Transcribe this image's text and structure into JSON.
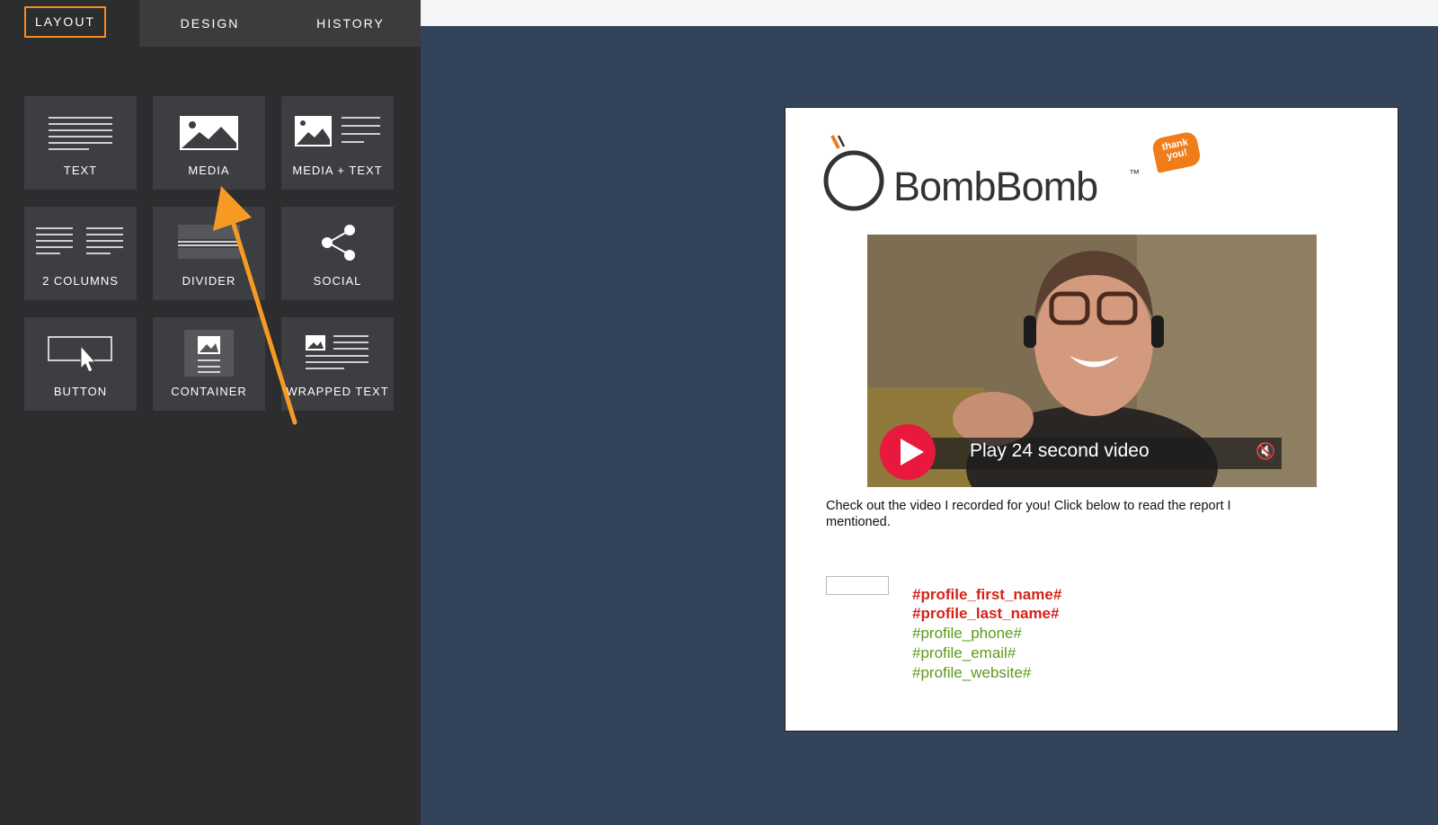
{
  "tabs": [
    {
      "label": "LAYOUT"
    },
    {
      "label": "DESIGN"
    },
    {
      "label": "HISTORY"
    }
  ],
  "tiles": [
    {
      "label": "TEXT",
      "icon": "text-lines-icon"
    },
    {
      "label": "MEDIA",
      "icon": "image-icon"
    },
    {
      "label": "MEDIA + TEXT",
      "icon": "image-text-icon"
    },
    {
      "label": "2 COLUMNS",
      "icon": "two-columns-icon"
    },
    {
      "label": "DIVIDER",
      "icon": "divider-icon"
    },
    {
      "label": "SOCIAL",
      "icon": "share-icon"
    },
    {
      "label": "BUTTON",
      "icon": "button-cursor-icon"
    },
    {
      "label": "CONTAINER",
      "icon": "container-icon"
    },
    {
      "label": "WRAPPED TEXT",
      "icon": "wrapped-text-icon"
    }
  ],
  "email": {
    "logo_text": "BombBomb",
    "logo_tm": "™",
    "badge_text": "thank you!",
    "video": {
      "play_label": "Play 24 second video",
      "mute_icon": "mute-icon"
    },
    "body_text": "Check out the video I recorded for you! Click below to read the report I mentioned.",
    "signature": {
      "first_name": "#profile_first_name#",
      "last_name": "#profile_last_name#",
      "phone": "#profile_phone#",
      "email": "#profile_email#",
      "website": "#profile_website#"
    }
  },
  "colors": {
    "sidebar_bg": "#2c2d2f",
    "tile_bg": "#3d3e41",
    "canvas_bg": "#334359",
    "accent_orange": "#f38e1c",
    "play_red": "#e8193c",
    "placeholder_red": "#d42418",
    "placeholder_green": "#5d9a1a"
  }
}
